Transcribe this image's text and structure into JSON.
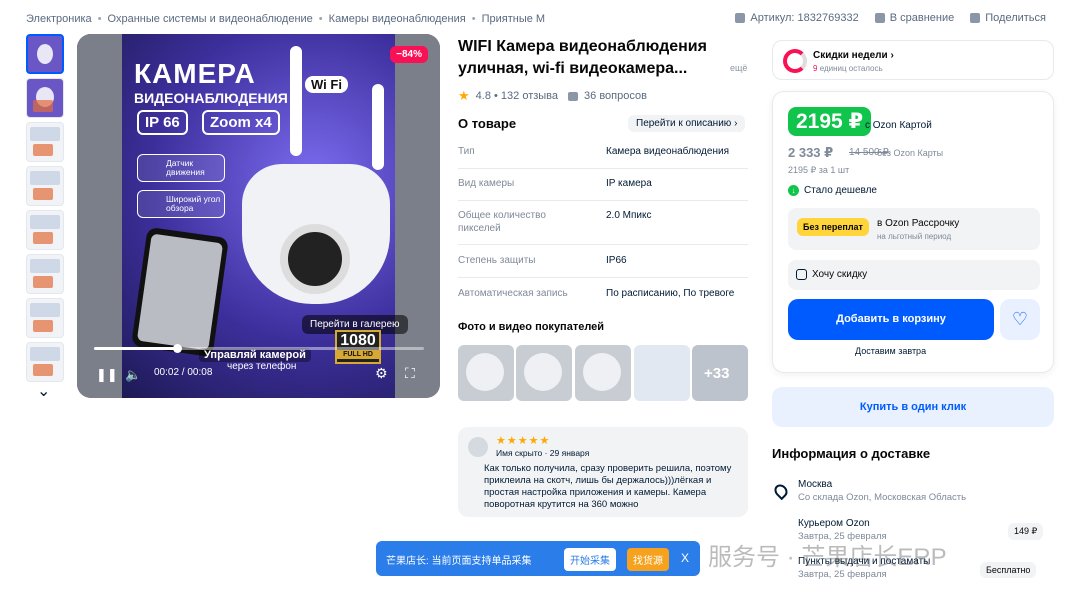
{
  "breadcrumb": [
    "Электроника",
    "Охранные системы и видеонаблюдение",
    "Камеры видеонаблюдения",
    "Приятные М"
  ],
  "meta": {
    "article": "Артикул: 1832769332",
    "compare": "В сравнение",
    "share": "Поделиться"
  },
  "media": {
    "title": "КАМЕРА",
    "subtitle": "ВИДЕОНАБЛЮДЕНИЯ",
    "tag1": "IP 66",
    "tag2": "Zoom x4",
    "wifi": "Wi Fi",
    "feat1": "Датчик движения",
    "feat2": "Широкий угол обзора",
    "discount": "−84%",
    "gallery": "Перейти в галерею",
    "hd": "1080",
    "hd_sub": "FULL HD",
    "manage": "Управляй камерой",
    "manage2": "через телефон",
    "time": "00:02 / 00:08",
    "progress": 0.25
  },
  "product": {
    "title": "WIFI Камера видеонаблюдения уличная, wi-fi видеокамера...",
    "more": "ещё",
    "rating": "4.8 • 132 отзыва",
    "questions": "36 вопросов",
    "about": "О товаре",
    "goto": "Перейти к описанию",
    "attributes": [
      {
        "k": "Тип",
        "v": "Камера видеонаблюдения"
      },
      {
        "k": "Вид камеры",
        "v": "IP камера"
      },
      {
        "k": "Общее количество пикселей",
        "v": "2.0 Мпикс"
      },
      {
        "k": "Степень защиты",
        "v": "IP66"
      },
      {
        "k": "Автоматическая запись",
        "v": "По расписанию, По тревоге"
      }
    ],
    "photos_title": "Фото и видео покупателей",
    "photos_more": "+33"
  },
  "review": {
    "stars": "★★★★★",
    "name": "Имя скрыто · 29 января",
    "text": "Как только получила, сразу проверить решила, поэтому приклеила на скотч, лишь бы держалось)))лёгкая и простая настройка приложения и камеры. Камера поворотная крутится на 360 можно"
  },
  "weekly": {
    "title": "Скидки недели ›",
    "count": "9",
    "sub": "единиц осталось"
  },
  "price": {
    "card": "2195 ₽",
    "card_label": "с Ozon Картой",
    "normal": "2 333 ₽",
    "old": "14 500 ₽",
    "nocard": "без Ozon Карты",
    "per": "2195 ₽ за 1 шт",
    "cheaper": "Стало дешевле",
    "rass_badge": "Без переплат",
    "rass1": "в Ozon Рассрочку",
    "rass2": "на льготный период",
    "want": "Хочу скидку",
    "add": "Добавить в корзину",
    "deliver": "Доставим завтра",
    "oneclick": "Купить в один клик"
  },
  "delivery": {
    "title": "Информация о доставке",
    "city": "Москва",
    "city_sub": "Со склада Ozon, Московская Область",
    "courier": "Курьером Ozon",
    "courier_sub": "Завтра, 25 февраля",
    "courier_price": "149 ₽",
    "pickup": "Пункты выдачи и постаматы",
    "pickup_sub": "Завтра, 25 февраля",
    "pickup_price": "Бесплатно"
  },
  "banner": {
    "label": "芒果店长: 当前页面支持单品采集",
    "collect": "开始采集",
    "find": "找货源",
    "close": "X"
  },
  "watermark": "服务号 · 芒果店长ERP",
  "colors": {
    "accent": "#005bff",
    "green": "#10c44c",
    "discount": "#f91155",
    "star": "#ffa800"
  }
}
